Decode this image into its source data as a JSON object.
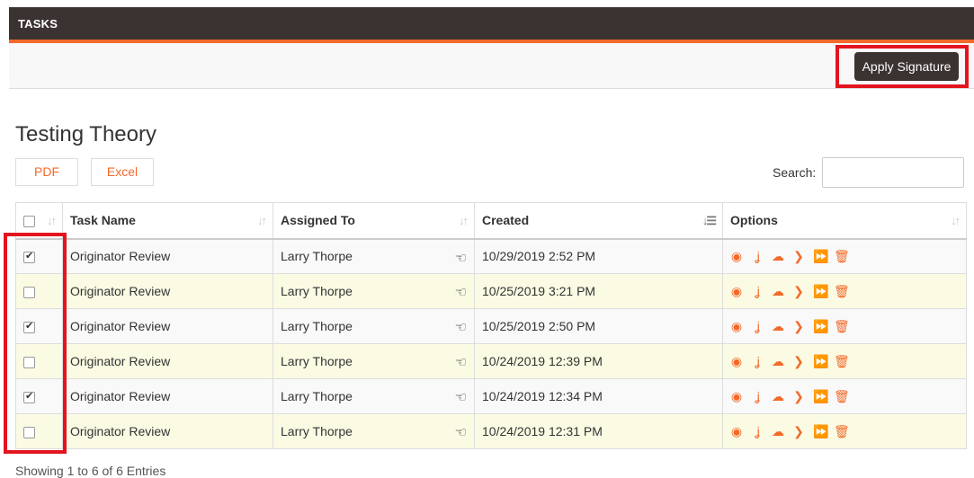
{
  "header": {
    "title": "TASKS"
  },
  "toolbar": {
    "apply_label": "Apply Signature"
  },
  "page": {
    "title": "Testing Theory"
  },
  "export": {
    "pdf_label": "PDF",
    "excel_label": "Excel"
  },
  "search": {
    "label": "Search:",
    "value": ""
  },
  "table": {
    "columns": [
      "Task Name",
      "Assigned To",
      "Created",
      "Options"
    ],
    "rows": [
      {
        "checked": true,
        "task": "Originator Review",
        "assigned": "Larry Thorpe",
        "created": "10/29/2019 2:52 PM"
      },
      {
        "checked": false,
        "task": "Originator Review",
        "assigned": "Larry Thorpe",
        "created": "10/25/2019 3:21 PM"
      },
      {
        "checked": true,
        "task": "Originator Review",
        "assigned": "Larry Thorpe",
        "created": "10/25/2019 2:50 PM"
      },
      {
        "checked": false,
        "task": "Originator Review",
        "assigned": "Larry Thorpe",
        "created": "10/24/2019 12:39 PM"
      },
      {
        "checked": true,
        "task": "Originator Review",
        "assigned": "Larry Thorpe",
        "created": "10/24/2019 12:34 PM"
      },
      {
        "checked": false,
        "task": "Originator Review",
        "assigned": "Larry Thorpe",
        "created": "10/24/2019 12:31 PM"
      }
    ],
    "option_icons": [
      "eye-icon",
      "sign-icon",
      "cloud-upload-icon",
      "next-icon",
      "fast-forward-icon",
      "trash-icon"
    ]
  },
  "footer": {
    "info": "Showing 1 to 6 of 6 Entries"
  },
  "colors": {
    "accent": "#f26a2a",
    "header_bg": "#3b3331",
    "highlight": "#e3141e"
  }
}
